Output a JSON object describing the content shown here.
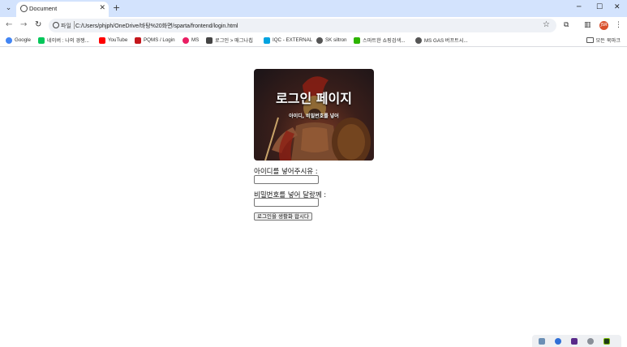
{
  "browser": {
    "tab_title": "Document",
    "omnibox": {
      "scheme_label": "파일",
      "url": "C:/Users/phjph/OneDrive/바탕%20화면/sparta/frontend/login.html"
    },
    "profile_initials": "JSR",
    "bookmarks": [
      {
        "label": "Google",
        "color": "#4285f4"
      },
      {
        "label": "네이버 : 나의 경쟁...",
        "color": "#03c75a"
      },
      {
        "label": "YouTube",
        "color": "#ff0000"
      },
      {
        "label": "PQMS / Login",
        "color": "#c4161c"
      },
      {
        "label": "MS",
        "color": "#e91e63"
      },
      {
        "label": "로그인 > 매그나칩",
        "color": "#444444"
      },
      {
        "label": "IQC - EXTERNAL",
        "color": "#00a3e0"
      },
      {
        "label": "SK siltron",
        "color": "#555555"
      },
      {
        "label": "스마트한 쇼핑검색...",
        "color": "#2db400"
      },
      {
        "label": "MS GAS 버프트시...",
        "color": "#555555"
      }
    ],
    "all_bookmarks_label": "모든 북마크"
  },
  "page": {
    "banner_title": "로그인 페이지",
    "banner_subtitle": "아이디, 비밀번호를 넣어",
    "id_label": "아이디를 넣어주시유 :",
    "id_value": "",
    "pw_label": "비밀번호를 넣어 달랑께 :",
    "pw_value": "",
    "submit_label": "로그인을 생활화 합시다"
  },
  "tray": {
    "icons": [
      "cloud-icon",
      "chat-icon",
      "app-icon",
      "bluetooth-icon",
      "nvidia-icon"
    ]
  }
}
